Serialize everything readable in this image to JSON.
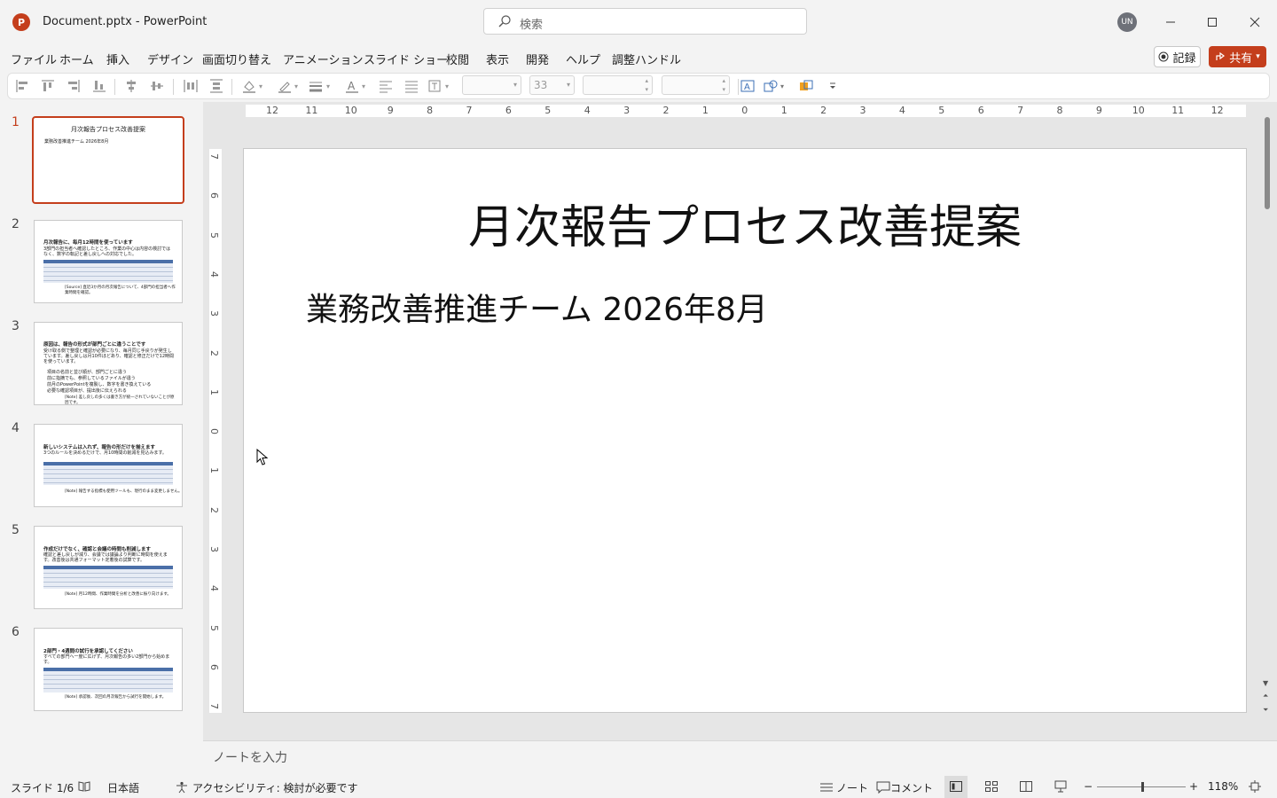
{
  "window": {
    "title": "Document.pptx  -  PowerPoint",
    "app_logo": "P"
  },
  "search": {
    "placeholder": "検索"
  },
  "user": {
    "initials": "UN"
  },
  "menu": [
    "ファイル",
    "ホーム",
    "挿入",
    "デザイン",
    "画面切り替え",
    "アニメーション",
    "スライド ショー",
    "校閲",
    "表示",
    "開発",
    "ヘルプ",
    "調整ハンドル"
  ],
  "actions": {
    "record": "記録",
    "share": "共有"
  },
  "ribbon": {
    "font_size": "33"
  },
  "ruler": {
    "h_ticks": [
      "12",
      "11",
      "10",
      "9",
      "8",
      "7",
      "6",
      "5",
      "4",
      "3",
      "2",
      "1",
      "0",
      "1",
      "2",
      "3",
      "4",
      "5",
      "6",
      "7",
      "8",
      "9",
      "10",
      "11",
      "12"
    ],
    "v_ticks": [
      "7",
      "6",
      "5",
      "4",
      "3",
      "2",
      "1",
      "0",
      "1",
      "2",
      "3",
      "4",
      "5",
      "6",
      "7"
    ]
  },
  "slides": [
    {
      "num": "1",
      "title": "月次報告プロセス改善提案",
      "subtitle": "業務改善推進チーム 2026年8月"
    },
    {
      "num": "2",
      "title": "月次報告に、毎月12時間を使っています",
      "body": "3部門の担当者へ確認したところ、作業の中心は内容の検討ではなく、数字の転記と差し戻しへの対応でした。",
      "note": "[Source] 直近3か月の月次報告について、4部門の担当者へ作業時間を確認。"
    },
    {
      "num": "3",
      "title": "原因は、報告の形式が部門ごとに違うことです",
      "body": "受け取る側で整理と確認が必要になり、毎月同じ手戻りが発生しています。差し戻しは月10件ほどあり、確認と修正だけで12時間を使っています。",
      "bullets": [
        "項目の名前と並び順が、部門ごとに違う",
        "前に指摘でも、参照しているファイルが違う",
        "前月のPowerPointを複製し、数字を書き換えている",
        "必要な確認項目が、提出後に伝えられる"
      ],
      "note": "[Note] 差し戻しの多くは書き方が統一されていないことが原因です。"
    },
    {
      "num": "4",
      "title": "新しいシステムは入れず、報告の形だけを揃えます",
      "body": "3つのルールを決めるだけで、月10時間の削減を見込みます。",
      "note": "[Note] 報告する指標も使用ツールも、現行のまま変更しません。"
    },
    {
      "num": "5",
      "title": "作成だけでなく、確認と会議の時間も削減します",
      "body": "確認と差し戻しが減り、会議では議論より判断に時間を使えます。改善後は共通フォーマット定着後の試算です。",
      "note": "[Note] 月12時間、作業時間を分析と改善に振り向けます。"
    },
    {
      "num": "6",
      "title": "2部門・4週間の試行を承認してください",
      "body": "すべての部門へ一度に広げず、月次報告の多い2部門から始めます。",
      "note": "[Note] 承認後、次回の月次報告から試行を開始します。"
    }
  ],
  "notes": {
    "placeholder": "ノートを入力"
  },
  "status": {
    "slide_counter": "スライド 1/6",
    "language": "日本語",
    "accessibility": "アクセシビリティ: 検討が必要です",
    "notes_btn": "ノート",
    "comments_btn": "コメント",
    "zoom": "118%",
    "zoom_minus": "−",
    "zoom_plus": "+"
  },
  "colors": {
    "accent": "#c43e1c",
    "table_header": "#4a6fa8",
    "background": "#f3f3f3"
  }
}
